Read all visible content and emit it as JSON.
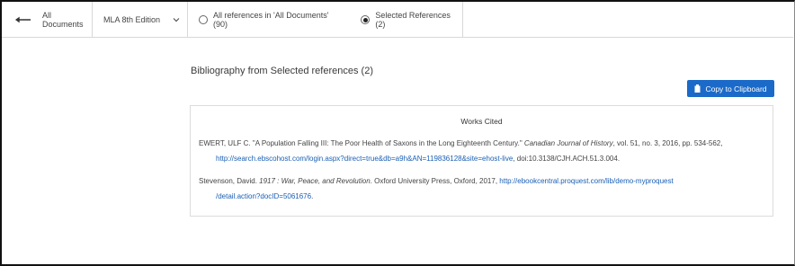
{
  "toolbar": {
    "back_label": "All Documents",
    "style_label": "MLA 8th Edition",
    "option_all": "All references in 'All Documents' (90)",
    "option_selected": "Selected References (2)",
    "selected_option": "option_selected"
  },
  "main": {
    "heading": "Bibliography from Selected references (2)",
    "copy_button": "Copy to Clipboard",
    "works_cited": "Works Cited",
    "entries": [
      {
        "pre": "EWERT, ULF C. \"A Population Falling III: The Poor Health of Saxons in the Long Eighteenth Century.\" ",
        "journal": "Canadian Journal of History",
        "post": ", vol. 51, no. 3, 2016, pp. 534-562,",
        "url": "http://search.ebscohost.com/login.aspx?direct=true&db=a9h&AN=119836128&site=ehost-live",
        "tail": ", doi:10.3138/CJH.ACH.51.3.004."
      },
      {
        "pre": "Stevenson, David. ",
        "title_num": "1917",
        "title_rest": " : War, Peace, and Revolution",
        "post": ". Oxford University Press, Oxford, 2017, ",
        "url1": "http://ebookcentral.proquest.com/lib/demo-myproquest",
        "url2": "/detail.action?docID=5061676",
        "tail": "."
      }
    ]
  },
  "colors": {
    "accent": "#1b6ac9",
    "link": "#1a5fb4"
  }
}
